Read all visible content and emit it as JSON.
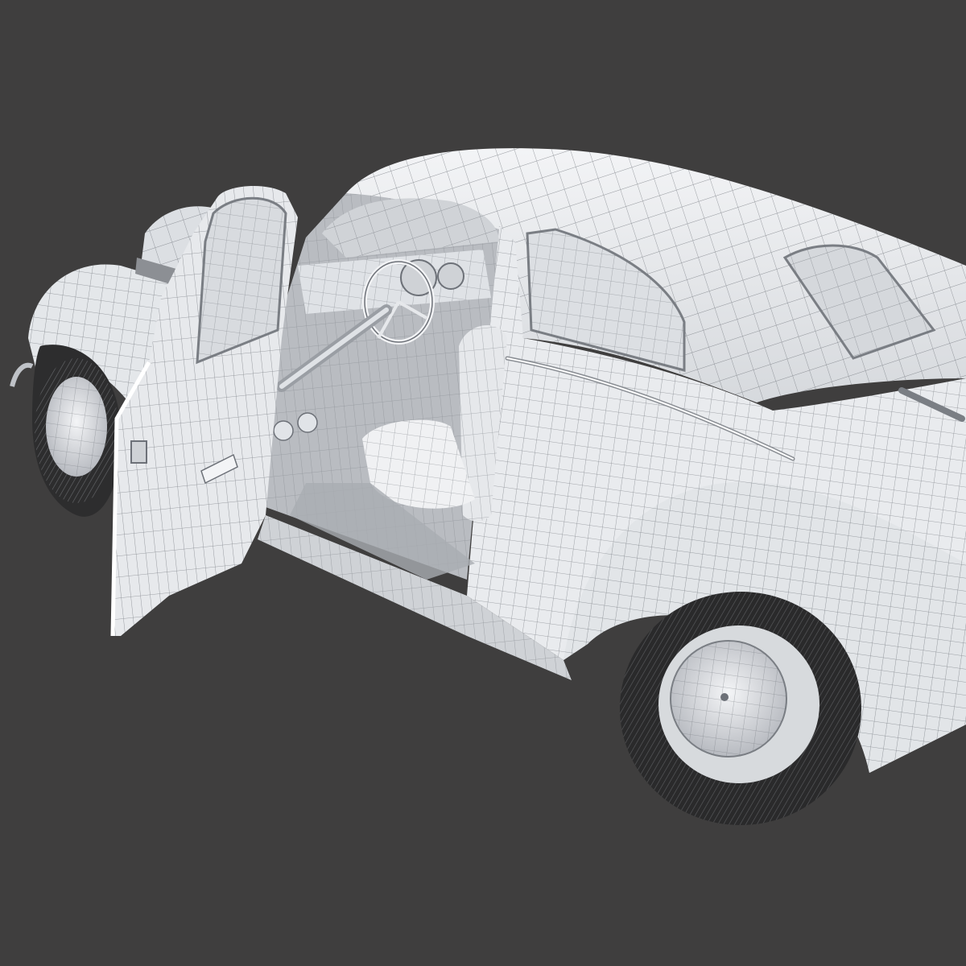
{
  "scene": {
    "subject": "",
    "render_style": "wireframe-over-clay",
    "colors": {
      "background": "#3f3e3e",
      "body": "#eef0f2",
      "body_shade": "#c9ccd0",
      "interior": "#b9bcc1",
      "interior_dark": "#8c8f94",
      "tire": "#2a2a2b",
      "wire": "#6d7178"
    }
  }
}
